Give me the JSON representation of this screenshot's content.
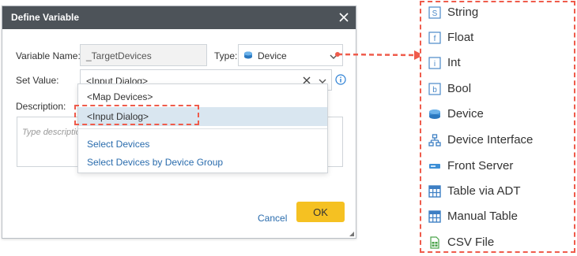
{
  "dialog": {
    "title": "Define Variable",
    "variable_name_label": "Variable Name:",
    "variable_name_value": "_TargetDevices",
    "type_label": "Type:",
    "type_value": "Device",
    "set_value_label": "Set Value:",
    "set_value_value": "<Input Dialog>",
    "description_label": "Description:",
    "description_placeholder": "Type description",
    "cancel_label": "Cancel",
    "ok_label": "OK"
  },
  "dropdown": {
    "items": [
      "<Map Devices>",
      "<Input Dialog>"
    ],
    "selected": "<Input Dialog>",
    "links": [
      "Select Devices",
      "Select Devices by Device Group"
    ]
  },
  "type_menu": {
    "items": [
      {
        "label": "String",
        "icon": "string-icon"
      },
      {
        "label": "Float",
        "icon": "float-icon"
      },
      {
        "label": "Int",
        "icon": "int-icon"
      },
      {
        "label": "Bool",
        "icon": "bool-icon"
      },
      {
        "label": "Device",
        "icon": "device-icon"
      },
      {
        "label": "Device Interface",
        "icon": "device-interface-icon"
      },
      {
        "label": "Front Server",
        "icon": "front-server-icon"
      },
      {
        "label": "Table via ADT",
        "icon": "table-icon"
      },
      {
        "label": "Manual Table",
        "icon": "table-icon"
      },
      {
        "label": "CSV File",
        "icon": "csv-file-icon"
      }
    ]
  },
  "colors": {
    "titlebar": "#4d5359",
    "accent_link": "#2a6cad",
    "ok_button": "#f5c122",
    "highlight_dash": "#ef5b4b",
    "selected_row": "#d9e6f0"
  }
}
